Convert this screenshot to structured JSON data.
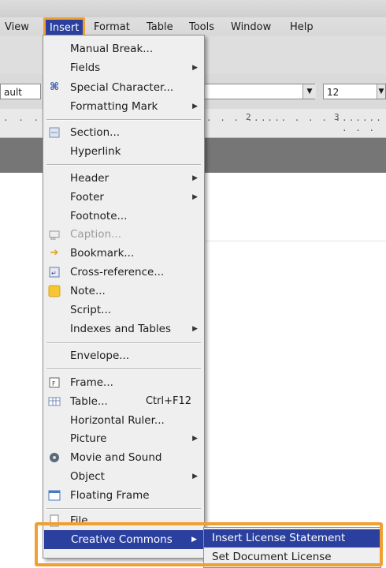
{
  "menubar": {
    "items": [
      "View",
      "Insert",
      "Format",
      "Table",
      "Tools",
      "Window",
      "Help"
    ],
    "active": "Insert"
  },
  "toolbar": {
    "font_name": "ault",
    "font_size": "12"
  },
  "ruler": {
    "marks": [
      "2",
      "3"
    ]
  },
  "insert_menu": {
    "items": [
      {
        "label": "Manual Break...",
        "arrow": false,
        "icon": ""
      },
      {
        "label": "Fields",
        "arrow": true,
        "icon": ""
      },
      {
        "label": "Special Character...",
        "arrow": false,
        "icon": "special-character-icon"
      },
      {
        "label": "Formatting Mark",
        "arrow": true,
        "icon": ""
      },
      {
        "label": "Section...",
        "arrow": false,
        "icon": "section-icon"
      },
      {
        "label": "Hyperlink",
        "arrow": false,
        "icon": ""
      },
      {
        "label": "Header",
        "arrow": true,
        "icon": ""
      },
      {
        "label": "Footer",
        "arrow": true,
        "icon": ""
      },
      {
        "label": "Footnote...",
        "arrow": false,
        "icon": ""
      },
      {
        "label": "Caption...",
        "arrow": false,
        "icon": "caption-icon",
        "disabled": true
      },
      {
        "label": "Bookmark...",
        "arrow": false,
        "icon": "bookmark-icon"
      },
      {
        "label": "Cross-reference...",
        "arrow": false,
        "icon": "cross-reference-icon"
      },
      {
        "label": "Note...",
        "arrow": false,
        "icon": "note-icon"
      },
      {
        "label": "Script...",
        "arrow": false,
        "icon": ""
      },
      {
        "label": "Indexes and Tables",
        "arrow": true,
        "icon": ""
      },
      {
        "label": "Envelope...",
        "arrow": false,
        "icon": ""
      },
      {
        "label": "Frame...",
        "arrow": false,
        "icon": "frame-icon"
      },
      {
        "label": "Table...",
        "shortcut": "Ctrl+F12",
        "arrow": false,
        "icon": "table-icon"
      },
      {
        "label": "Horizontal Ruler...",
        "arrow": false,
        "icon": ""
      },
      {
        "label": "Picture",
        "arrow": true,
        "icon": ""
      },
      {
        "label": "Movie and Sound",
        "arrow": false,
        "icon": "movie-icon"
      },
      {
        "label": "Object",
        "arrow": true,
        "icon": ""
      },
      {
        "label": "Floating Frame",
        "arrow": false,
        "icon": "floating-frame-icon"
      },
      {
        "label": "File...",
        "arrow": false,
        "icon": "file-icon"
      },
      {
        "label": "Creative Commons",
        "arrow": true,
        "icon": ""
      }
    ]
  },
  "cc_submenu": {
    "items": [
      "Insert License Statement",
      "Set Document License"
    ]
  },
  "colors": {
    "highlight": "#2a3f9e",
    "annotation": "#f0a033"
  }
}
